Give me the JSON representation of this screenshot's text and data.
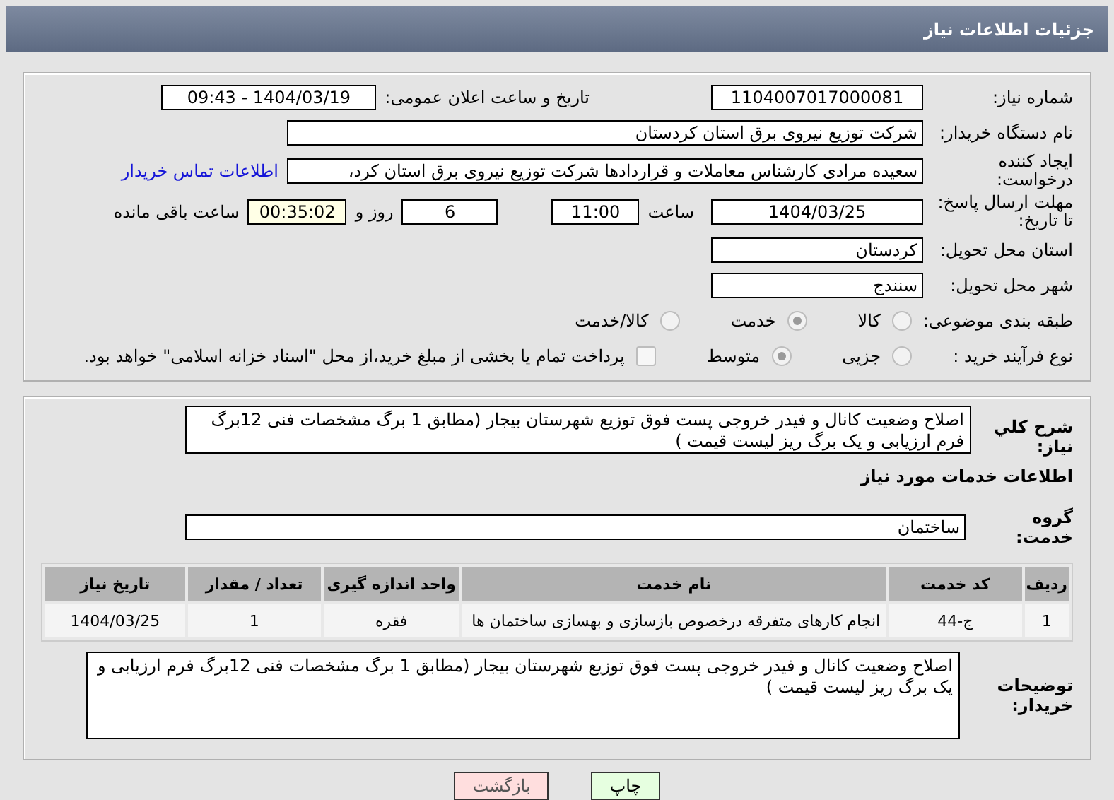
{
  "header": {
    "title": "جزئیات اطلاعات نیاز"
  },
  "details": {
    "need_number": {
      "label": "شماره نیاز:",
      "value": "1104007017000081"
    },
    "announce": {
      "label": "تاریخ و ساعت اعلان عمومی:",
      "value": "1404/03/19 - 09:43"
    },
    "buyer": {
      "label": "نام دستگاه خریدار:",
      "value": "شرکت توزیع نیروی برق استان کردستان"
    },
    "creator": {
      "label": "ایجاد کننده درخواست:",
      "value": "سعیده مرادی کارشناس معاملات و قراردادها شرکت توزیع نیروی برق استان کرد،",
      "link": "اطلاعات تماس خریدار"
    },
    "deadline": {
      "label": "مهلت ارسال پاسخ: تا تاریخ:",
      "date": "1404/03/25",
      "time_label": "ساعت",
      "time": "11:00",
      "days": "6",
      "days_label": "روز و",
      "remaining": "00:35:02",
      "remaining_label": "ساعت باقی مانده"
    },
    "province": {
      "label": "استان محل تحویل:",
      "value": "کردستان"
    },
    "city": {
      "label": "شهر محل تحویل:",
      "value": "سنندج"
    },
    "category": {
      "label": "طبقه بندی موضوعی:",
      "options": [
        {
          "label": "کالا",
          "selected": false
        },
        {
          "label": "خدمت",
          "selected": true
        },
        {
          "label": "کالا/خدمت",
          "selected": false
        }
      ]
    },
    "process": {
      "label": "نوع فرآیند خرید :",
      "options": [
        {
          "label": "جزیی",
          "selected": false
        },
        {
          "label": "متوسط",
          "selected": true
        }
      ],
      "payment": {
        "checked": false,
        "label": "پرداخت تمام یا بخشی از مبلغ خرید،از محل \"اسناد خزانه اسلامی\" خواهد بود."
      }
    }
  },
  "summary": {
    "label": "شرح کلي نياز:",
    "value": "اصلاح وضعیت کانال و فیدر خروجی پست فوق توزیع شهرستان بیجار (مطابق 1 برگ مشخصات فنی 12برگ فرم ارزیابی و یک برگ  ریز لیست قیمت )"
  },
  "services": {
    "heading": "اطلاعات خدمات مورد نیاز",
    "group_label": "گروه خدمت:",
    "group": "ساختمان",
    "table": {
      "columns": [
        "ردیف",
        "کد خدمت",
        "نام خدمت",
        "واحد اندازه گیری",
        "تعداد / مقدار",
        "تاریخ نیاز"
      ],
      "rows": [
        [
          "1",
          "ج-44",
          "انجام کارهای متفرقه درخصوص بازسازی و بهسازی ساختمان ها",
          "فقره",
          "1",
          "1404/03/25"
        ]
      ]
    }
  },
  "buyer_notes": {
    "label": "توضیحات خریدار:",
    "value": "اصلاح وضعیت کانال و فیدر خروجی پست فوق توزیع شهرستان بیجار (مطابق 1 برگ مشخصات فنی 12برگ فرم ارزیابی و یک برگ  ریز لیست قیمت )"
  },
  "buttons": [
    {
      "label": "چاپ",
      "kind": "print"
    },
    {
      "label": "بازگشت",
      "kind": "back"
    }
  ]
}
